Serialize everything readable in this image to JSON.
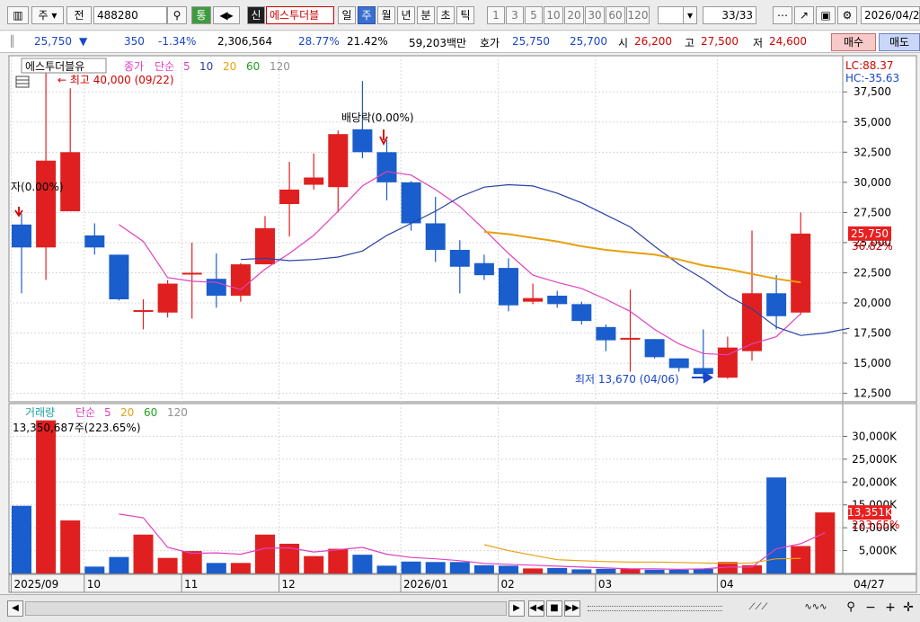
{
  "toolbar": {
    "market_label": "주",
    "period_label": "전",
    "code": "488280",
    "btn_tong": "통",
    "btn_sin": "신",
    "name": "에스투더블",
    "periods": [
      "일",
      "주",
      "월",
      "년",
      "분",
      "초",
      "틱"
    ],
    "selected_period": "주",
    "intervals": [
      "1",
      "3",
      "5",
      "10",
      "20",
      "30",
      "60",
      "120"
    ],
    "page": "33/33",
    "date": "2026/04/2"
  },
  "quote": {
    "price": "25,750",
    "change": "350",
    "change_pct": "-1.34%",
    "volume": "2,306,564",
    "ratio1": "28.77%",
    "ratio2": "21.42%",
    "amount": "59,203백만",
    "hoga_label": "호가",
    "hoga1": "25,750",
    "hoga2": "25,700",
    "open_label": "시",
    "open": "26,200",
    "high_label": "고",
    "high": "27,500",
    "low_label": "저",
    "low": "24,600",
    "buy": "매수",
    "sell": "매도"
  },
  "chart_data": [
    {
      "type": "candlestick",
      "legend": {
        "name": "에스투더블유",
        "close_label": "종가",
        "ma_label": "단순",
        "ma_periods": [
          "5",
          "10",
          "20",
          "60",
          "120"
        ]
      },
      "info": {
        "lc": "LC:88.37",
        "hc": "HC:-35.63"
      },
      "annotations": {
        "high": "최고 40,000 (09/22)",
        "low": "최저 13,670 (04/06)",
        "dividend": "배당락(0.00%)",
        "rights": "자(0.00%)"
      },
      "current": {
        "price": "25,750",
        "pct": "36.82%"
      },
      "y_ticks": [
        "37,500",
        "35,000",
        "32,500",
        "30,000",
        "27,500",
        "25,000",
        "22,500",
        "20,000",
        "17,500",
        "15,000",
        "12,500"
      ],
      "ylim": [
        11800,
        40500
      ],
      "candles": [
        {
          "o": 26500,
          "h": 27400,
          "l": 20800,
          "c": 24600
        },
        {
          "o": 24600,
          "h": 40000,
          "l": 21900,
          "c": 31800
        },
        {
          "o": 27600,
          "h": 37800,
          "l": 27600,
          "c": 32500
        },
        {
          "o": 25600,
          "h": 26600,
          "l": 24000,
          "c": 24600
        },
        {
          "o": 24000,
          "h": 24000,
          "l": 20200,
          "c": 20300
        },
        {
          "o": 19400,
          "h": 20300,
          "l": 17800,
          "c": 19400
        },
        {
          "o": 19200,
          "h": 21900,
          "l": 18800,
          "c": 21600
        },
        {
          "o": 22400,
          "h": 25000,
          "l": 18700,
          "c": 22500
        },
        {
          "o": 22000,
          "h": 24100,
          "l": 19600,
          "c": 20600
        },
        {
          "o": 20600,
          "h": 23300,
          "l": 20100,
          "c": 23200
        },
        {
          "o": 23200,
          "h": 27200,
          "l": 23200,
          "c": 26200
        },
        {
          "o": 28200,
          "h": 31700,
          "l": 25500,
          "c": 29400
        },
        {
          "o": 29800,
          "h": 32400,
          "l": 29400,
          "c": 30400
        },
        {
          "o": 29600,
          "h": 34300,
          "l": 27500,
          "c": 34000
        },
        {
          "o": 34400,
          "h": 38400,
          "l": 32000,
          "c": 32500
        },
        {
          "o": 32500,
          "h": 33500,
          "l": 28500,
          "c": 30000
        },
        {
          "o": 30000,
          "h": 30100,
          "l": 26000,
          "c": 26600
        },
        {
          "o": 26600,
          "h": 28800,
          "l": 23400,
          "c": 24400
        },
        {
          "o": 24400,
          "h": 25200,
          "l": 20800,
          "c": 23000
        },
        {
          "o": 23300,
          "h": 24000,
          "l": 21900,
          "c": 22300
        },
        {
          "o": 22900,
          "h": 23700,
          "l": 19300,
          "c": 19800
        },
        {
          "o": 20100,
          "h": 21600,
          "l": 19900,
          "c": 20400
        },
        {
          "o": 20600,
          "h": 21000,
          "l": 19600,
          "c": 19900
        },
        {
          "o": 19900,
          "h": 20100,
          "l": 18200,
          "c": 18500
        },
        {
          "o": 18000,
          "h": 18200,
          "l": 16000,
          "c": 16900
        },
        {
          "o": 17000,
          "h": 21100,
          "l": 14300,
          "c": 17100
        },
        {
          "o": 17000,
          "h": 17000,
          "l": 15400,
          "c": 15500
        },
        {
          "o": 15400,
          "h": 15400,
          "l": 14300,
          "c": 14600
        },
        {
          "o": 14600,
          "h": 17800,
          "l": 13670,
          "c": 14100
        },
        {
          "o": 13800,
          "h": 17200,
          "l": 13700,
          "c": 16300
        },
        {
          "o": 16000,
          "h": 26000,
          "l": 15200,
          "c": 20800
        },
        {
          "o": 20800,
          "h": 22300,
          "l": 17800,
          "c": 18900
        },
        {
          "o": 19200,
          "h": 27500,
          "l": 19000,
          "c": 25750
        }
      ],
      "ma5": [
        null,
        null,
        null,
        null,
        26500,
        25100,
        22100,
        21800,
        21700,
        21100,
        22800,
        24100,
        25600,
        27600,
        29700,
        30900,
        30600,
        29400,
        28000,
        26100,
        24100,
        22300,
        21700,
        21200,
        20300,
        19300,
        17800,
        16600,
        15800,
        15700,
        16600,
        17200,
        19100
      ],
      "ma10": [
        null,
        null,
        null,
        null,
        null,
        null,
        null,
        null,
        null,
        23600,
        23700,
        23500,
        23600,
        23800,
        24300,
        25600,
        26600,
        27600,
        28800,
        29600,
        29800,
        29700,
        29100,
        28300,
        27300,
        26300,
        24700,
        23200,
        22000,
        20600,
        19500,
        18000,
        17300,
        17500,
        17900
      ],
      "ma20": [
        null,
        null,
        null,
        null,
        null,
        null,
        null,
        null,
        null,
        null,
        null,
        null,
        null,
        null,
        null,
        null,
        null,
        null,
        null,
        25900,
        25700,
        25400,
        25100,
        24700,
        24400,
        24200,
        24000,
        23600,
        23100,
        22800,
        22400,
        22000,
        21700
      ]
    },
    {
      "type": "bar",
      "legend": {
        "name": "거래량",
        "ma_label": "단순",
        "ma_periods": [
          "5",
          "20",
          "60",
          "120"
        ]
      },
      "summary": "13,350,687주(223.65%)",
      "current": {
        "value": "13,351K",
        "pct": "223.65%"
      },
      "y_ticks": [
        "30,000K",
        "25,000K",
        "20,000K",
        "15,000K",
        "10,000K",
        "5,000K"
      ],
      "ylim": [
        0,
        35000
      ],
      "values": [
        14800,
        33500,
        11600,
        1500,
        3600,
        8500,
        3400,
        4900,
        2300,
        2300,
        8500,
        6500,
        3800,
        5400,
        4100,
        1700,
        2600,
        2500,
        2500,
        1800,
        1700,
        1100,
        1200,
        900,
        1000,
        1000,
        800,
        800,
        1000,
        2500,
        1800,
        21000,
        6000,
        13351
      ],
      "ma5": [
        null,
        null,
        null,
        null,
        13000,
        12200,
        5700,
        4400,
        4500,
        4200,
        5500,
        5600,
        4700,
        5200,
        5700,
        4200,
        3500,
        3200,
        2800,
        2200,
        2000,
        1800,
        1600,
        1400,
        1200,
        1000,
        1000,
        900,
        1000,
        1400,
        1400,
        5400,
        6500,
        8900
      ],
      "ma20": [
        null,
        null,
        null,
        null,
        null,
        null,
        null,
        null,
        null,
        null,
        null,
        null,
        null,
        null,
        null,
        null,
        null,
        null,
        null,
        6300,
        5000,
        4000,
        3000,
        2800,
        2600,
        2500,
        2500,
        2400,
        2300,
        2200,
        2300,
        3200,
        3300
      ]
    }
  ],
  "x_axis": {
    "labels": [
      "2025/09",
      "10",
      "11",
      "12",
      "2026/01",
      "02",
      "03",
      "04"
    ],
    "positions": [
      0,
      3,
      7,
      11,
      16,
      20,
      24,
      29
    ],
    "last_date": "04/27"
  },
  "colors": {
    "up": "#e02020",
    "down": "#1a5dcc",
    "ma5": "#e040c0",
    "ma10": "#2a40a8",
    "ma20": "#e8a010",
    "ma60": "#20a020",
    "ma120": "#909090",
    "axis_bg": "#ffffff",
    "label_bg": "#e82020"
  }
}
